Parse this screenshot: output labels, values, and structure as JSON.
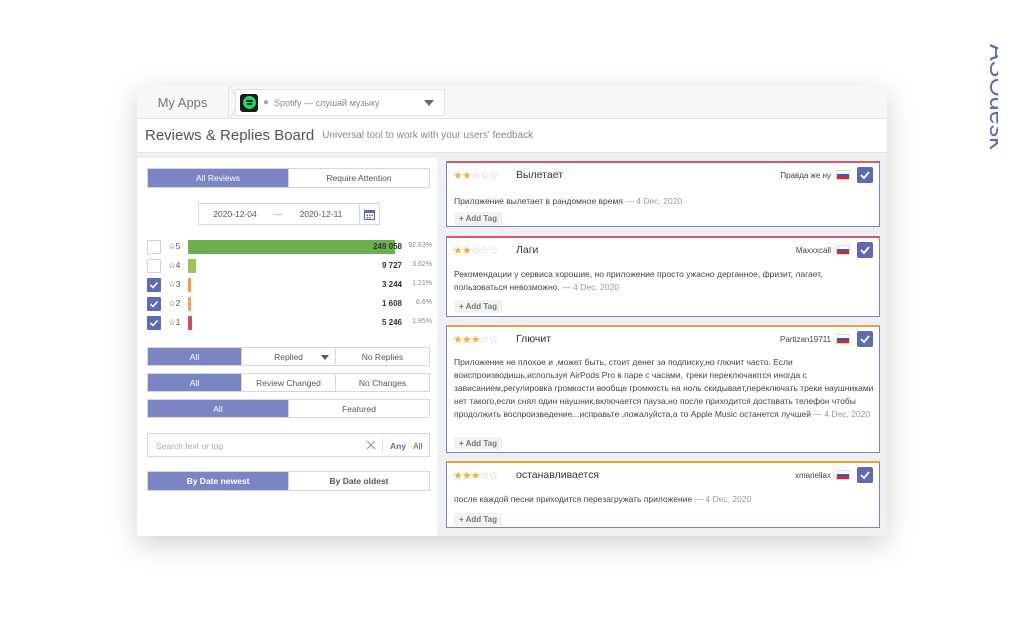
{
  "brand": {
    "logo_text": "ASOdesk",
    "accent": "#5f6ab5"
  },
  "breadcrumb": {
    "my_apps": "My Apps",
    "platform_icon": "apple-icon",
    "app_name": "Spotify — слушай музыку"
  },
  "header": {
    "title": "Reviews & Replies Board",
    "subtitle": "Universal tool to work with your users' feedback"
  },
  "filters": {
    "review_tabs": [
      "All Reviews",
      "Require Attention"
    ],
    "date_from": "2020-12-04",
    "date_separator": "—",
    "date_to": "2020-12-11",
    "ratings": [
      {
        "label": "☆5",
        "count": "249 058",
        "percent": "92.63%",
        "share": 0.926,
        "checked": false,
        "color": "#6ab04c"
      },
      {
        "label": "☆4",
        "count": "9 727",
        "percent": "3.62%",
        "share": 0.036,
        "checked": false,
        "color": "#a3c255"
      },
      {
        "label": "☆3",
        "count": "3 244",
        "percent": "1.21%",
        "share": 0.012,
        "checked": true,
        "color": "#f0a030"
      },
      {
        "label": "☆2",
        "count": "1 608",
        "percent": "0.6%",
        "share": 0.006,
        "checked": true,
        "color": "#f0a070"
      },
      {
        "label": "☆1",
        "count": "5 246",
        "percent": "1.95%",
        "share": 0.02,
        "checked": true,
        "color": "#c9505c"
      }
    ],
    "reply_tabs": [
      "All",
      "Replied",
      "No Replies"
    ],
    "change_tabs": [
      "All",
      "Review Changed",
      "No Changes"
    ],
    "featured_tabs": [
      "All",
      "Featured"
    ],
    "search_placeholder": "Search text or tag",
    "match_any": "Any",
    "match_all": "All",
    "sort_tabs": [
      "By Date newest",
      "By Date oldest"
    ]
  },
  "reviews": [
    {
      "rating": 2,
      "title": "Вылетает",
      "author": "Правда же ну",
      "text": "Приложение вылетает в рандомное время",
      "date": "— 4 Dec, 2020",
      "add_tag": "+ Add Tag",
      "accent": "#d65a6a"
    },
    {
      "rating": 2,
      "title": "Лаги",
      "author": "Maxxxcall",
      "text": "Рекомендации у сервиса хорошие, но приложение просто ужасно дерганное, фризит, лагает, пользоваться невозможно.",
      "date": "— 4 Dec, 2020",
      "add_tag": "+ Add Tag",
      "accent": "#d65a6a"
    },
    {
      "rating": 3,
      "title": "Глючит",
      "author": "Partizan19711",
      "text": "Приложение не плохое и ,может быть, стоит денег за подписку,но глючит часто. Если воиспроизводишь,используя AirPods Pro в паре с часами, треки переключаются иногда с зависанием,регулировка громкости вообще громкость на ноль скидывает,переключать треки наушниками нет такого,если снял один наушник,включается пауза,но после приходится доставать телефон чтобы продолжить воспроизведение...исправьте ,пожалуйста,а то Apple Music останется лучшей",
      "date": "— 4 Dec, 2020",
      "add_tag": "+ Add Tag",
      "accent": "#e8a33c"
    },
    {
      "rating": 3,
      "title": "останавливается",
      "author": "xmariellax",
      "text": "после каждой песни приходится перезагружать приложение",
      "date": "— 4 Dec, 2020",
      "add_tag": "+ Add Tag",
      "accent": "#e8a33c"
    }
  ]
}
